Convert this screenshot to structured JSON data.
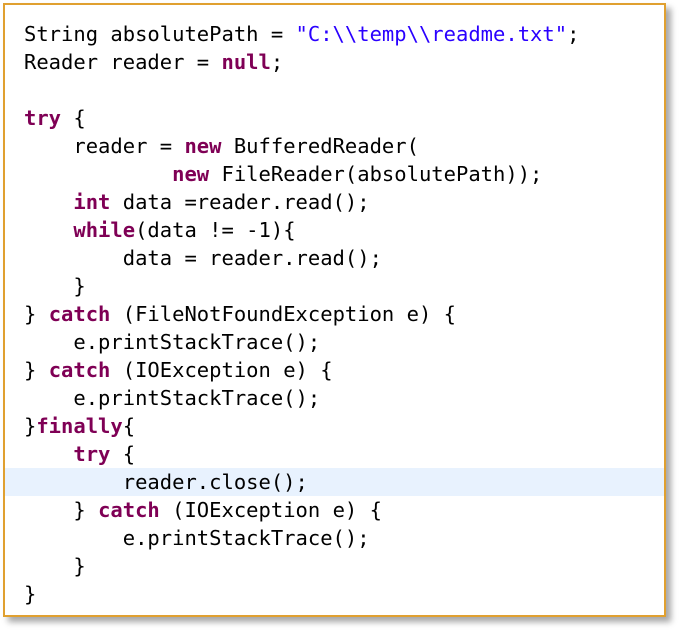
{
  "code_lines": [
    {
      "segments": [
        {
          "t": "String absolutePath = ",
          "c": "plain"
        },
        {
          "t": "\"C:\\\\temp\\\\readme.txt\"",
          "c": "str"
        },
        {
          "t": ";",
          "c": "plain"
        }
      ]
    },
    {
      "segments": [
        {
          "t": "Reader reader = ",
          "c": "plain"
        },
        {
          "t": "null",
          "c": "kw"
        },
        {
          "t": ";",
          "c": "plain"
        }
      ]
    },
    {
      "segments": []
    },
    {
      "segments": [
        {
          "t": "try",
          "c": "kw"
        },
        {
          "t": " {",
          "c": "plain"
        }
      ]
    },
    {
      "segments": [
        {
          "t": "    reader = ",
          "c": "plain"
        },
        {
          "t": "new",
          "c": "kw"
        },
        {
          "t": " BufferedReader(",
          "c": "plain"
        }
      ]
    },
    {
      "segments": [
        {
          "t": "            ",
          "c": "plain"
        },
        {
          "t": "new",
          "c": "kw"
        },
        {
          "t": " FileReader(absolutePath));",
          "c": "plain"
        }
      ]
    },
    {
      "segments": [
        {
          "t": "    ",
          "c": "plain"
        },
        {
          "t": "int",
          "c": "kw"
        },
        {
          "t": " data =reader.read();",
          "c": "plain"
        }
      ]
    },
    {
      "segments": [
        {
          "t": "    ",
          "c": "plain"
        },
        {
          "t": "while",
          "c": "kw"
        },
        {
          "t": "(data != -1){",
          "c": "plain"
        }
      ]
    },
    {
      "segments": [
        {
          "t": "        data = reader.read();",
          "c": "plain"
        }
      ]
    },
    {
      "segments": [
        {
          "t": "    }",
          "c": "plain"
        }
      ]
    },
    {
      "segments": [
        {
          "t": "} ",
          "c": "plain"
        },
        {
          "t": "catch",
          "c": "kw"
        },
        {
          "t": " (FileNotFoundException e) {",
          "c": "plain"
        }
      ]
    },
    {
      "segments": [
        {
          "t": "    e.printStackTrace();",
          "c": "plain"
        }
      ]
    },
    {
      "segments": [
        {
          "t": "} ",
          "c": "plain"
        },
        {
          "t": "catch",
          "c": "kw"
        },
        {
          "t": " (IOException e) {",
          "c": "plain"
        }
      ]
    },
    {
      "segments": [
        {
          "t": "    e.printStackTrace();",
          "c": "plain"
        }
      ]
    },
    {
      "segments": [
        {
          "t": "}",
          "c": "plain"
        },
        {
          "t": "finally",
          "c": "kw"
        },
        {
          "t": "{",
          "c": "plain"
        }
      ]
    },
    {
      "segments": [
        {
          "t": "    ",
          "c": "plain"
        },
        {
          "t": "try",
          "c": "kw"
        },
        {
          "t": " {",
          "c": "plain"
        }
      ]
    },
    {
      "segments": [
        {
          "t": "        reader.close();",
          "c": "plain"
        }
      ],
      "highlight": true
    },
    {
      "segments": [
        {
          "t": "    } ",
          "c": "plain"
        },
        {
          "t": "catch",
          "c": "kw"
        },
        {
          "t": " (IOException e) {",
          "c": "plain"
        }
      ]
    },
    {
      "segments": [
        {
          "t": "        e.printStackTrace();",
          "c": "plain"
        }
      ]
    },
    {
      "segments": [
        {
          "t": "    }",
          "c": "plain"
        }
      ]
    },
    {
      "segments": [
        {
          "t": "}",
          "c": "plain"
        }
      ]
    }
  ],
  "colors": {
    "keyword": "#7f0055",
    "string": "#2a00ff",
    "text": "#000000",
    "current_line_highlight": "#e8f2fe",
    "frame_border": "#e0a030"
  }
}
